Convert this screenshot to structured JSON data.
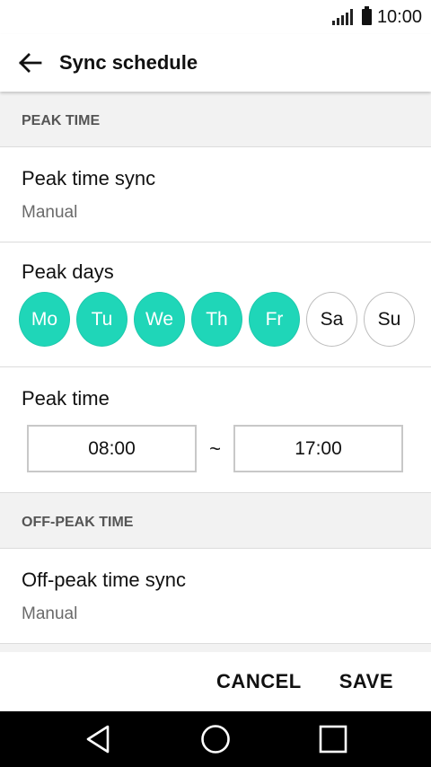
{
  "status_bar": {
    "time": "10:00",
    "signal_icon": "signal-icon",
    "battery_icon": "battery-icon"
  },
  "app_bar": {
    "back_icon": "arrow-left-icon",
    "title": "Sync schedule"
  },
  "peak_section": {
    "header": "PEAK TIME",
    "sync": {
      "title": "Peak time sync",
      "value": "Manual"
    },
    "days": {
      "title": "Peak days",
      "items": [
        {
          "label": "Mo",
          "selected": true
        },
        {
          "label": "Tu",
          "selected": true
        },
        {
          "label": "We",
          "selected": true
        },
        {
          "label": "Th",
          "selected": true
        },
        {
          "label": "Fr",
          "selected": true
        },
        {
          "label": "Sa",
          "selected": false
        },
        {
          "label": "Su",
          "selected": false
        }
      ]
    },
    "time": {
      "title": "Peak time",
      "start": "08:00",
      "separator": "~",
      "end": "17:00"
    }
  },
  "offpeak_section": {
    "header": "OFF-PEAK TIME",
    "sync": {
      "title": "Off-peak time sync",
      "value": "Manual"
    }
  },
  "actions": {
    "cancel_label": "CANCEL",
    "save_label": "SAVE"
  },
  "nav_bar": {
    "back_icon": "triangle-back-icon",
    "home_icon": "circle-home-icon",
    "recents_icon": "square-recents-icon"
  },
  "colors": {
    "accent": "#1fd6b8",
    "background": "#f2f2f2",
    "nav_bar": "#000000"
  }
}
